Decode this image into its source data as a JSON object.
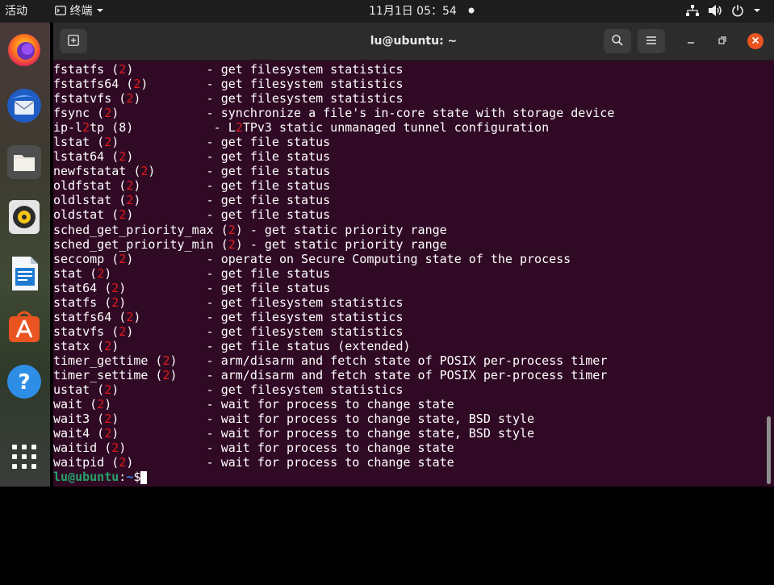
{
  "topbar": {
    "activities": "活动",
    "app_menu_label": "终端",
    "clock": "11月1日  05：54",
    "dropdown_icon": "chevron-down-icon"
  },
  "dock": {
    "items": [
      {
        "name": "firefox",
        "icon": "firefox-icon"
      },
      {
        "name": "thunderbird",
        "icon": "thunderbird-icon"
      },
      {
        "name": "files",
        "icon": "files-icon"
      },
      {
        "name": "rhythmbox",
        "icon": "rhythmbox-icon"
      },
      {
        "name": "libreoffice-writer",
        "icon": "writer-icon"
      },
      {
        "name": "ubuntu-software",
        "icon": "software-icon"
      },
      {
        "name": "help",
        "icon": "help-icon"
      },
      {
        "name": "show-applications",
        "icon": "grid-icon"
      }
    ],
    "help_glyph": "?"
  },
  "window": {
    "title": "lu@ubuntu: ~"
  },
  "terminal": {
    "lines": [
      [
        {
          "t": "fstatfs ("
        },
        {
          "t": "2",
          "hl": true
        },
        {
          "t": ")          - get filesystem statistics"
        }
      ],
      [
        {
          "t": "fstatfs64 ("
        },
        {
          "t": "2",
          "hl": true
        },
        {
          "t": ")        - get filesystem statistics"
        }
      ],
      [
        {
          "t": "fstatvfs ("
        },
        {
          "t": "2",
          "hl": true
        },
        {
          "t": ")         - get filesystem statistics"
        }
      ],
      [
        {
          "t": "fsync ("
        },
        {
          "t": "2",
          "hl": true
        },
        {
          "t": ")            - synchronize a file's in-core state with storage device"
        }
      ],
      [
        {
          "t": "ip-l"
        },
        {
          "t": "2",
          "hl": true
        },
        {
          "t": "tp (8)           - L"
        },
        {
          "t": "2",
          "hl": true
        },
        {
          "t": "TPv3 static unmanaged tunnel configuration"
        }
      ],
      [
        {
          "t": "lstat ("
        },
        {
          "t": "2",
          "hl": true
        },
        {
          "t": ")            - get file status"
        }
      ],
      [
        {
          "t": "lstat64 ("
        },
        {
          "t": "2",
          "hl": true
        },
        {
          "t": ")          - get file status"
        }
      ],
      [
        {
          "t": "newfstatat ("
        },
        {
          "t": "2",
          "hl": true
        },
        {
          "t": ")       - get file status"
        }
      ],
      [
        {
          "t": "oldfstat ("
        },
        {
          "t": "2",
          "hl": true
        },
        {
          "t": ")         - get file status"
        }
      ],
      [
        {
          "t": "oldlstat ("
        },
        {
          "t": "2",
          "hl": true
        },
        {
          "t": ")         - get file status"
        }
      ],
      [
        {
          "t": "oldstat ("
        },
        {
          "t": "2",
          "hl": true
        },
        {
          "t": ")          - get file status"
        }
      ],
      [
        {
          "t": "sched_get_priority_max ("
        },
        {
          "t": "2",
          "hl": true
        },
        {
          "t": ") - get static priority range"
        }
      ],
      [
        {
          "t": "sched_get_priority_min ("
        },
        {
          "t": "2",
          "hl": true
        },
        {
          "t": ") - get static priority range"
        }
      ],
      [
        {
          "t": "seccomp ("
        },
        {
          "t": "2",
          "hl": true
        },
        {
          "t": ")          - operate on Secure Computing state of the process"
        }
      ],
      [
        {
          "t": "stat ("
        },
        {
          "t": "2",
          "hl": true
        },
        {
          "t": ")             - get file status"
        }
      ],
      [
        {
          "t": "stat64 ("
        },
        {
          "t": "2",
          "hl": true
        },
        {
          "t": ")           - get file status"
        }
      ],
      [
        {
          "t": "statfs ("
        },
        {
          "t": "2",
          "hl": true
        },
        {
          "t": ")           - get filesystem statistics"
        }
      ],
      [
        {
          "t": "statfs64 ("
        },
        {
          "t": "2",
          "hl": true
        },
        {
          "t": ")         - get filesystem statistics"
        }
      ],
      [
        {
          "t": "statvfs ("
        },
        {
          "t": "2",
          "hl": true
        },
        {
          "t": ")          - get filesystem statistics"
        }
      ],
      [
        {
          "t": "statx ("
        },
        {
          "t": "2",
          "hl": true
        },
        {
          "t": ")            - get file status (extended)"
        }
      ],
      [
        {
          "t": "timer_gettime ("
        },
        {
          "t": "2",
          "hl": true
        },
        {
          "t": ")    - arm/disarm and fetch state of POSIX per-process timer"
        }
      ],
      [
        {
          "t": "timer_settime ("
        },
        {
          "t": "2",
          "hl": true
        },
        {
          "t": ")    - arm/disarm and fetch state of POSIX per-process timer"
        }
      ],
      [
        {
          "t": "ustat ("
        },
        {
          "t": "2",
          "hl": true
        },
        {
          "t": ")            - get filesystem statistics"
        }
      ],
      [
        {
          "t": "wait ("
        },
        {
          "t": "2",
          "hl": true
        },
        {
          "t": ")             - wait for process to change state"
        }
      ],
      [
        {
          "t": "wait3 ("
        },
        {
          "t": "2",
          "hl": true
        },
        {
          "t": ")            - wait for process to change state, BSD style"
        }
      ],
      [
        {
          "t": "wait4 ("
        },
        {
          "t": "2",
          "hl": true
        },
        {
          "t": ")            - wait for process to change state, BSD style"
        }
      ],
      [
        {
          "t": "waitid ("
        },
        {
          "t": "2",
          "hl": true
        },
        {
          "t": ")           - wait for process to change state"
        }
      ],
      [
        {
          "t": "waitpid ("
        },
        {
          "t": "2",
          "hl": true
        },
        {
          "t": ")          - wait for process to change state"
        }
      ]
    ],
    "prompt": {
      "user": "lu@ubuntu",
      "sep": ":",
      "path": "~",
      "symbol": "$"
    }
  }
}
